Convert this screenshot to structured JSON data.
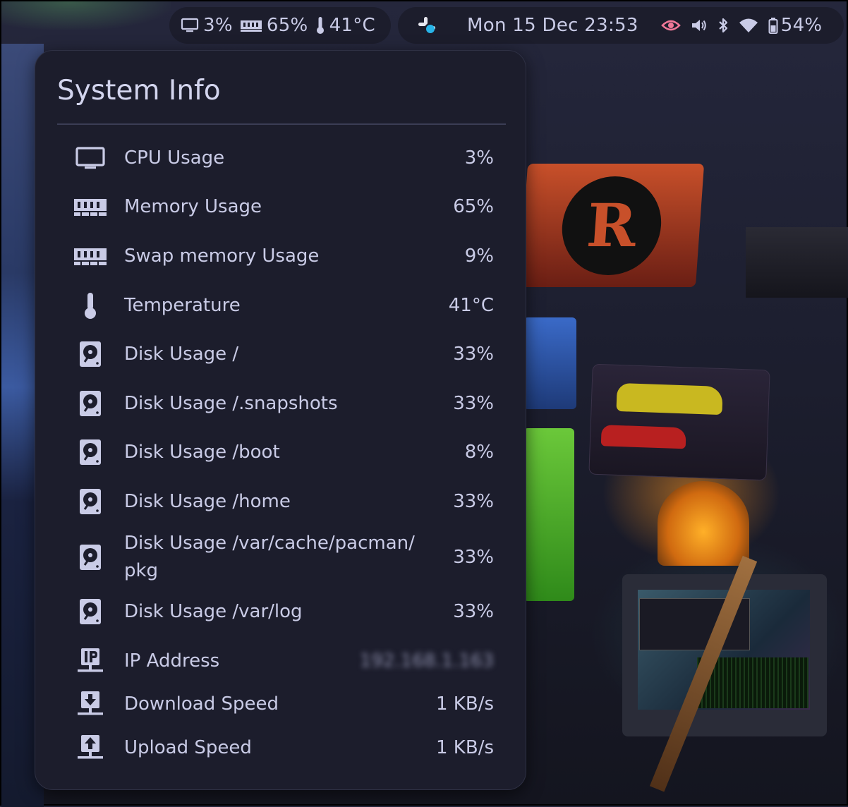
{
  "top_bar": {
    "stats": {
      "cpu": "3%",
      "memory": "65%",
      "temperature": "41°C"
    },
    "clock": "Mon 15 Dec 23:53",
    "battery": "54%"
  },
  "popup": {
    "title": "System Info",
    "rows": [
      {
        "icon": "monitor-icon",
        "label": "CPU Usage",
        "value": "3%"
      },
      {
        "icon": "memory-icon",
        "label": "Memory Usage",
        "value": "65%"
      },
      {
        "icon": "memory-icon",
        "label": "Swap memory Usage",
        "value": "9%"
      },
      {
        "icon": "thermometer-icon",
        "label": "Temperature",
        "value": "41°C"
      },
      {
        "icon": "disk-icon",
        "label": "Disk Usage /",
        "value": "33%"
      },
      {
        "icon": "disk-icon",
        "label": "Disk Usage /.snapshots",
        "value": "33%"
      },
      {
        "icon": "disk-icon",
        "label": "Disk Usage /boot",
        "value": "8%"
      },
      {
        "icon": "disk-icon",
        "label": "Disk Usage /home",
        "value": "33%"
      },
      {
        "icon": "disk-icon",
        "label": "Disk Usage /var/cache/pacman/\npkg",
        "value": "33%"
      },
      {
        "icon": "disk-icon",
        "label": "Disk Usage /var/log",
        "value": "33%"
      },
      {
        "icon": "ip-icon",
        "label": "IP Address",
        "value": "192.168.1.163"
      },
      {
        "icon": "download-icon",
        "label": "Download Speed",
        "value": "1 KB/s"
      },
      {
        "icon": "upload-icon",
        "label": "Upload Speed",
        "value": "1 KB/s"
      }
    ]
  },
  "colors": {
    "panel_bg": "#1c1d2c",
    "text": "#c9cbe6",
    "privacy_indicator": "#f07898",
    "separator": "#3b3d55"
  }
}
